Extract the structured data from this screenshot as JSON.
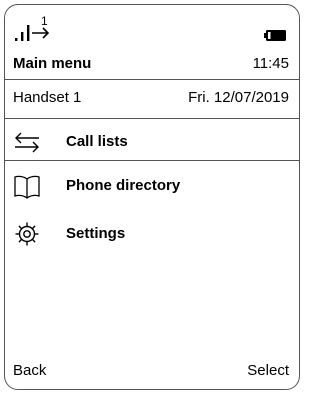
{
  "status": {
    "line_number": "1",
    "signal_icon": "signal-icon",
    "battery_icon": "battery-icon"
  },
  "header": {
    "title": "Main menu",
    "time": "11:45",
    "handset": "Handset 1",
    "date": "Fri. 12/07/2019"
  },
  "menu": {
    "items": [
      {
        "label": "Call lists",
        "icon": "call-lists-icon"
      },
      {
        "label": "Phone directory",
        "icon": "phone-directory-icon"
      },
      {
        "label": "Settings",
        "icon": "settings-gear-icon"
      }
    ]
  },
  "softkeys": {
    "left": "Back",
    "right": "Select"
  }
}
